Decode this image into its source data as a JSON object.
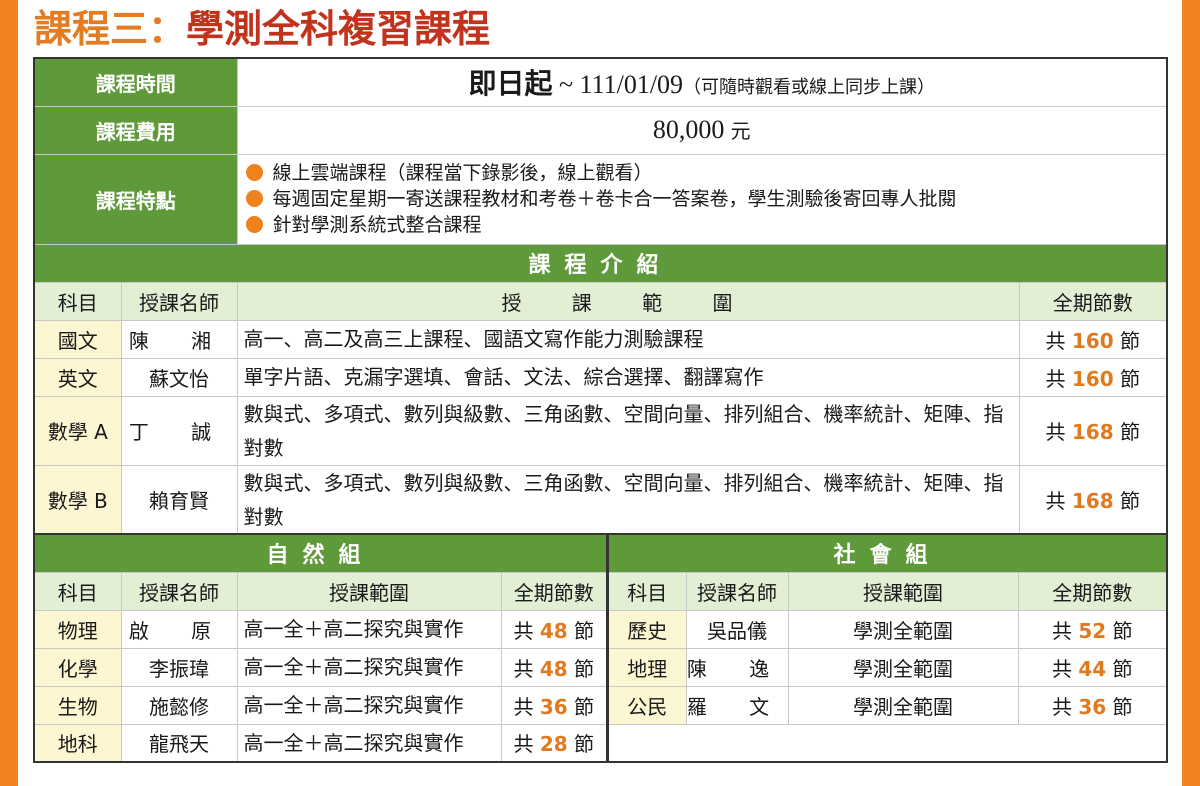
{
  "title": {
    "prefix": "課程三：",
    "main": "學測全科複習課程"
  },
  "info": {
    "time": {
      "label": "課程時間",
      "bold": "即日起",
      "tilde": " ~ ",
      "date": "111/01/09",
      "note": "（可隨時觀看或線上同步上課）"
    },
    "fee": {
      "label": "課程費用",
      "amount": "80,000",
      "unit": "元"
    },
    "features": {
      "label": "課程特點",
      "items": [
        "線上雲端課程（課程當下錄影後，線上觀看）",
        "每週固定星期一寄送課程教材和考卷＋卷卡合一答案卷，學生測驗後寄回專人批閱",
        "針對學測系統式整合課程"
      ]
    }
  },
  "intro": {
    "section_title": "課程介紹",
    "headers": {
      "subject": "科目",
      "teacher": "授課名師",
      "scope": "授 課 範 圍",
      "hours": "全期節數"
    },
    "rows": [
      {
        "subject": "國文",
        "teacher": "陳 湘",
        "scope": "高一、高二及高三上課程、國語文寫作能力測驗課程",
        "pre": "共 ",
        "num": "160",
        "post": " 節"
      },
      {
        "subject": "英文",
        "teacher": "蘇文怡",
        "scope": "單字片語、克漏字選填、會話、文法、綜合選擇、翻譯寫作",
        "pre": "共 ",
        "num": "160",
        "post": " 節"
      },
      {
        "subject": "數學 A",
        "teacher": "丁 誠",
        "scope": "數與式、多項式、數列與級數、三角函數、空間向量、排列組合、機率統計、矩陣、指對數",
        "pre": "共 ",
        "num": "168",
        "post": " 節"
      },
      {
        "subject": "數學 B",
        "teacher": "賴育賢",
        "scope": "數與式、多項式、數列與級數、三角函數、空間向量、排列組合、機率統計、矩陣、指對數",
        "pre": "共 ",
        "num": "168",
        "post": " 節"
      }
    ]
  },
  "science": {
    "section_title": "自然組",
    "headers": {
      "subject": "科目",
      "teacher": "授課名師",
      "scope": "授課範圍",
      "hours": "全期節數"
    },
    "rows": [
      {
        "subject": "物理",
        "teacher": "啟 原",
        "scope": "高一全＋高二探究與實作",
        "pre": "共 ",
        "num": "48",
        "post": " 節"
      },
      {
        "subject": "化學",
        "teacher": "李振瑋",
        "scope": "高一全＋高二探究與實作",
        "pre": "共 ",
        "num": "48",
        "post": " 節"
      },
      {
        "subject": "生物",
        "teacher": "施懿修",
        "scope": "高一全＋高二探究與實作",
        "pre": "共 ",
        "num": "36",
        "post": " 節"
      },
      {
        "subject": "地科",
        "teacher": "龍飛天",
        "scope": "高一全＋高二探究與實作",
        "pre": "共 ",
        "num": "28",
        "post": " 節"
      }
    ]
  },
  "social": {
    "section_title": "社會組",
    "headers": {
      "subject": "科目",
      "teacher": "授課名師",
      "scope": "授課範圍",
      "hours": "全期節數"
    },
    "rows": [
      {
        "subject": "歷史",
        "teacher": "吳品儀",
        "scope": "學測全範圍",
        "pre": "共 ",
        "num": "52",
        "post": " 節"
      },
      {
        "subject": "地理",
        "teacher": "陳 逸",
        "scope": "學測全範圍",
        "pre": "共 ",
        "num": "44",
        "post": " 節"
      },
      {
        "subject": "公民",
        "teacher": "羅 文",
        "scope": "學測全範圍",
        "pre": "共 ",
        "num": "36",
        "post": " 節"
      }
    ]
  },
  "colors": {
    "green": "#5f9a3a",
    "orange": "#f0821e",
    "header_bg": "#e2efd5",
    "subject_bg": "#fdf6d2",
    "title_red": "#c2331d",
    "title_orange": "#e37c22"
  }
}
